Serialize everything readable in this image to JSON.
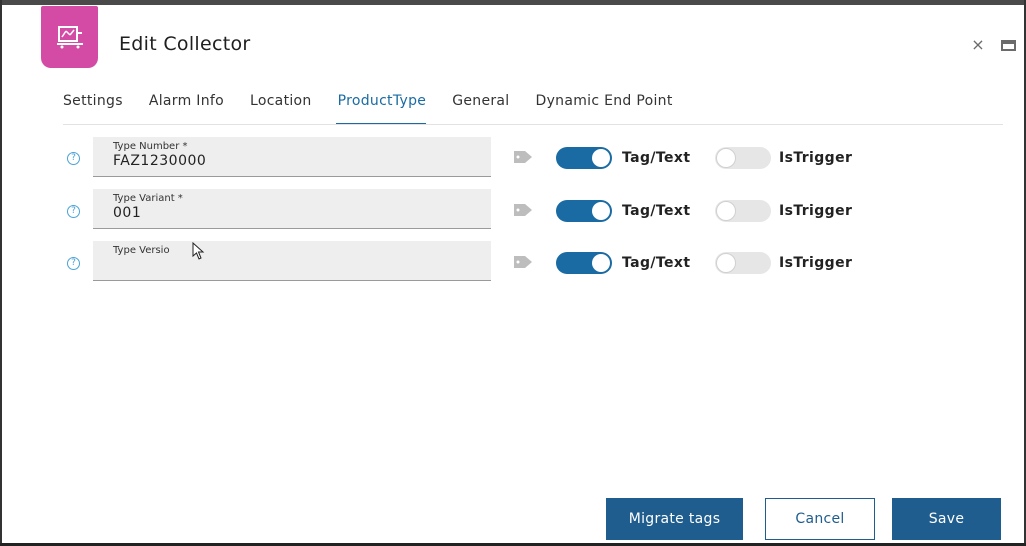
{
  "header": {
    "title": "Edit Collector",
    "app_icon": "collector-icon",
    "accent_color": "#d44ba6"
  },
  "window_controls": {
    "close_glyph": "×",
    "minimize_icon": "minimize-icon"
  },
  "tabs": [
    {
      "label": "Settings",
      "active": false
    },
    {
      "label": "Alarm Info",
      "active": false
    },
    {
      "label": "Location",
      "active": false
    },
    {
      "label": "ProductType",
      "active": true
    },
    {
      "label": "General",
      "active": false
    },
    {
      "label": "Dynamic End Point",
      "active": false
    }
  ],
  "fields": [
    {
      "label": "Type Number *",
      "value": "FAZ1230000",
      "tag_text_on": true,
      "tag_text_label": "Tag/Text",
      "is_trigger_on": false,
      "is_trigger_label": "IsTrigger"
    },
    {
      "label": "Type Variant *",
      "value": "001",
      "tag_text_on": true,
      "tag_text_label": "Tag/Text",
      "is_trigger_on": false,
      "is_trigger_label": "IsTrigger"
    },
    {
      "label": "Type Versio",
      "value": "",
      "tag_text_on": true,
      "tag_text_label": "Tag/Text",
      "is_trigger_on": false,
      "is_trigger_label": "IsTrigger"
    }
  ],
  "help_glyph": "?",
  "buttons": {
    "migrate": "Migrate tags",
    "cancel": "Cancel",
    "save": "Save"
  },
  "colors": {
    "primary": "#1f5d8f",
    "active_tab": "#1a6ba3",
    "toggle_on": "#1a6ba3",
    "help": "#4aa3d8"
  }
}
